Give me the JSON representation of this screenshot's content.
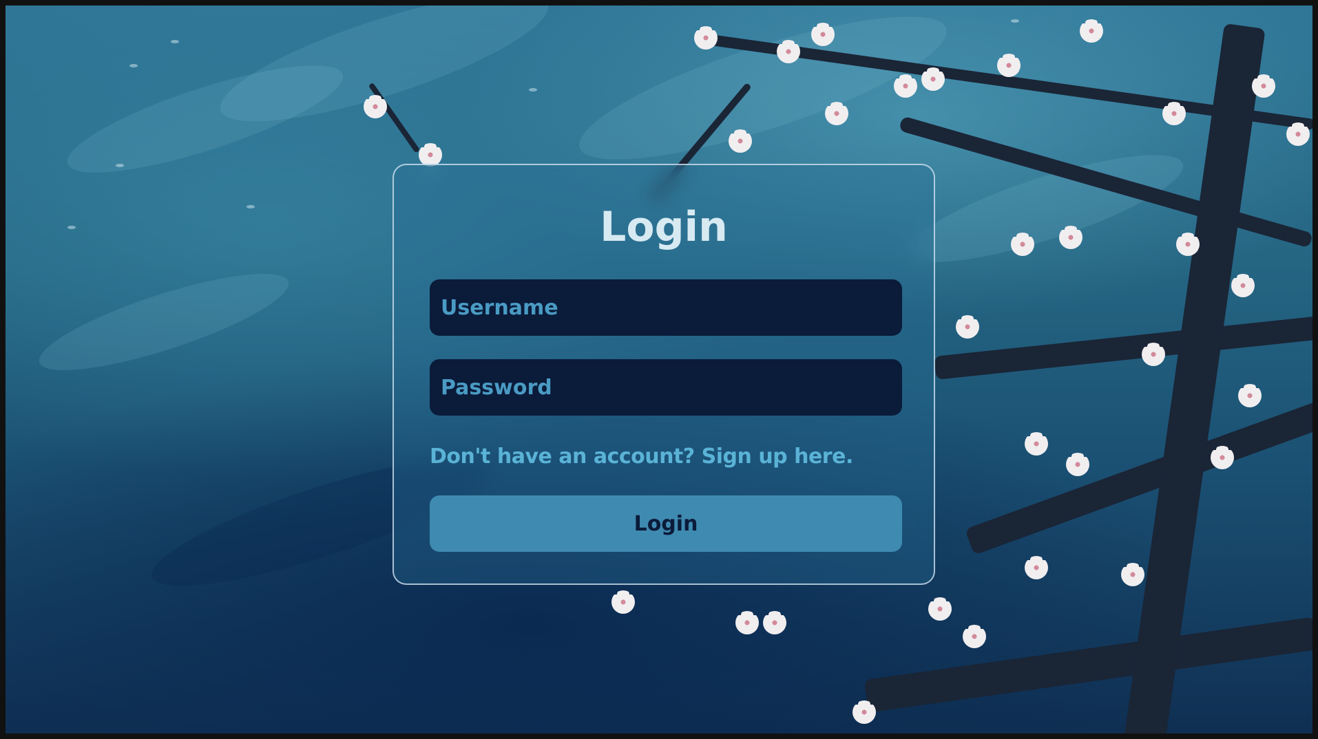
{
  "login_card": {
    "title": "Login",
    "username_placeholder": "Username",
    "password_placeholder": "Password",
    "signup_link": "Don't have an account? Sign up here.",
    "submit_label": "Login"
  },
  "colors": {
    "background": "#256683",
    "input_background": "#0b1b3a",
    "placeholder_text": "#4a9bc4",
    "link_text": "#5ab3d6",
    "button_background": "#3f8ab0",
    "button_text": "#0b1b3a",
    "title_text": "#d7eaf2"
  },
  "background_art": "cherry-blossom-branch-painting"
}
